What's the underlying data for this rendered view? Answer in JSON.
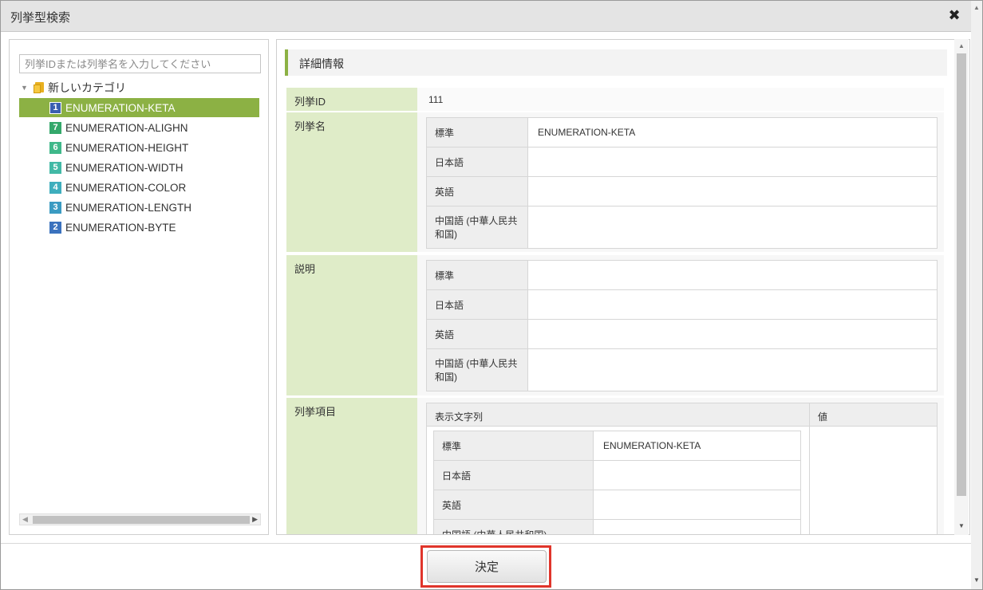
{
  "dialog": {
    "title": "列挙型検索",
    "close_icon": "✖"
  },
  "search": {
    "placeholder": "列挙IDまたは列挙名を入力してください"
  },
  "tree": {
    "root_label": "新しいカテゴリ",
    "items": [
      {
        "num": "1",
        "label": "ENUMERATION-KETA",
        "color": "#3a5fb0",
        "selected": true
      },
      {
        "num": "7",
        "label": "ENUMERATION-ALIGHN",
        "color": "#34a86b"
      },
      {
        "num": "6",
        "label": "ENUMERATION-HEIGHT",
        "color": "#3fb88a"
      },
      {
        "num": "5",
        "label": "ENUMERATION-WIDTH",
        "color": "#42b9a6"
      },
      {
        "num": "4",
        "label": "ENUMERATION-COLOR",
        "color": "#3eaebd"
      },
      {
        "num": "3",
        "label": "ENUMERATION-LENGTH",
        "color": "#3b9bc2"
      },
      {
        "num": "2",
        "label": "ENUMERATION-BYTE",
        "color": "#3b72be"
      }
    ]
  },
  "detail": {
    "heading": "詳細情報",
    "id_label": "列挙ID",
    "id_value": "111",
    "name_label": "列挙名",
    "name_rows": [
      {
        "k": "標準",
        "v": "ENUMERATION-KETA"
      },
      {
        "k": "日本語",
        "v": ""
      },
      {
        "k": "英語",
        "v": ""
      },
      {
        "k": "中国語 (中華人民共和国)",
        "v": ""
      }
    ],
    "desc_label": "説明",
    "desc_rows": [
      {
        "k": "標準",
        "v": ""
      },
      {
        "k": "日本語",
        "v": ""
      },
      {
        "k": "英語",
        "v": ""
      },
      {
        "k": "中国語 (中華人民共和国)",
        "v": ""
      }
    ],
    "items_label": "列挙項目",
    "items_header_display": "表示文字列",
    "items_header_value": "値",
    "item_rows": [
      {
        "k": "標準",
        "v": "ENUMERATION-KETA"
      },
      {
        "k": "日本語",
        "v": ""
      },
      {
        "k": "英語",
        "v": ""
      },
      {
        "k": "中国語 (中華人民共和国)",
        "v": ""
      }
    ]
  },
  "footer": {
    "ok_label": "決定"
  },
  "colors": {
    "accent": "#8cb144",
    "label_bg": "#dfecc8",
    "highlight": "#e0352b"
  }
}
